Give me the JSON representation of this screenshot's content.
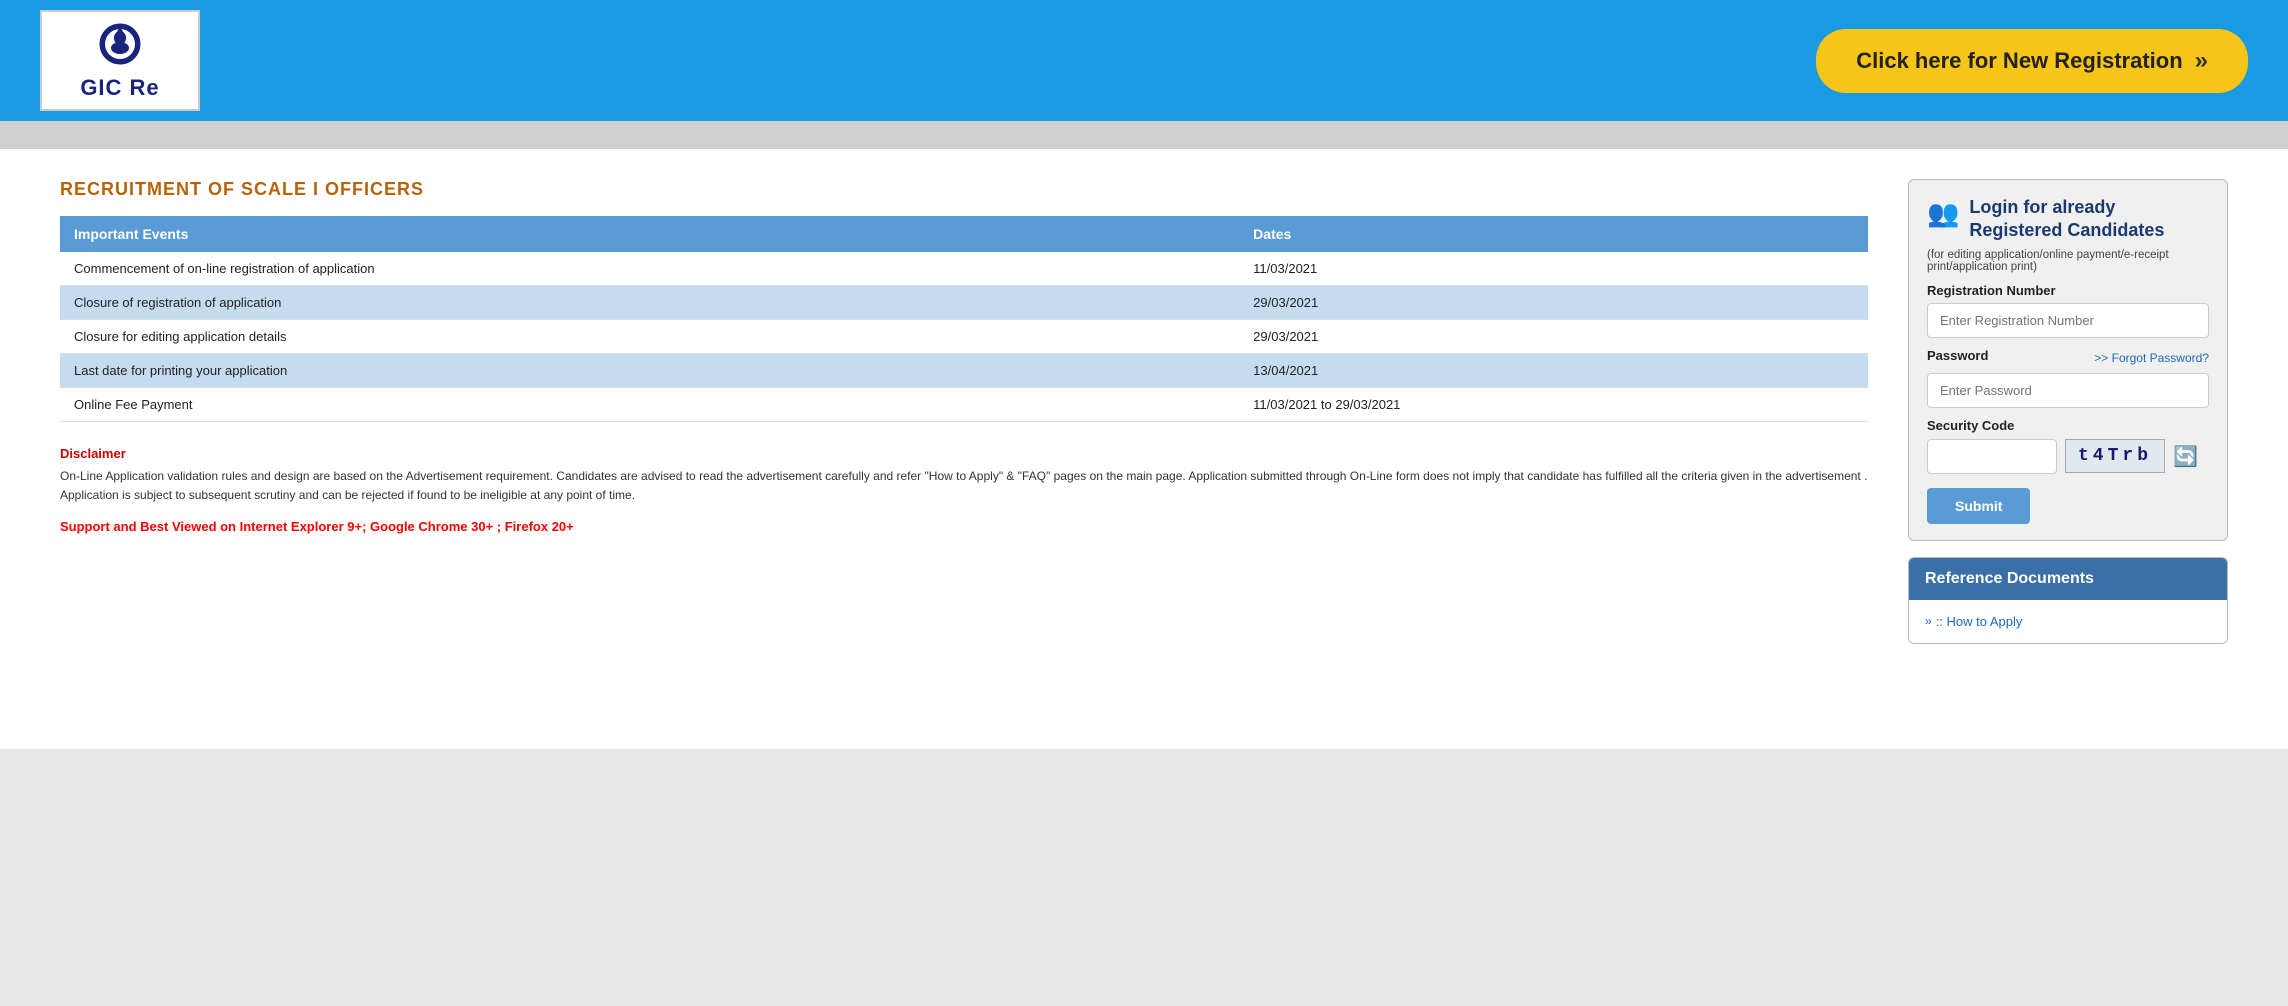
{
  "header": {
    "logo_text": "GIC Re",
    "new_registration_label": "Click here for New Registration",
    "new_registration_chevrons": "»"
  },
  "main": {
    "page_title": "RECRUITMENT OF SCALE I OFFICERS",
    "table": {
      "col_events": "Important Events",
      "col_dates": "Dates",
      "rows": [
        {
          "event": "Commencement of on-line registration of application",
          "date": "11/03/2021",
          "highlighted": false
        },
        {
          "event": "Closure of registration of application",
          "date": "29/03/2021",
          "highlighted": true
        },
        {
          "event": "Closure for editing application details",
          "date": "29/03/2021",
          "highlighted": false
        },
        {
          "event": "Last date for printing your application",
          "date": "13/04/2021",
          "highlighted": true
        },
        {
          "event": "Online Fee Payment",
          "date": "11/03/2021 to 29/03/2021",
          "highlighted": false
        }
      ]
    },
    "disclaimer_title": "Disclaimer",
    "disclaimer_text": "On-Line Application validation rules and design are based on the Advertisement requirement. Candidates are advised to read the advertisement carefully and refer \"How to Apply\" & \"FAQ\" pages on the main page. Application submitted through On-Line form does not imply that candidate has fulfilled all the criteria given in the advertisement . Application is subject to subsequent scrutiny and can be rejected if found to be ineligible at any point of time.",
    "support_text": "Support and Best Viewed on Internet Explorer 9+; Google Chrome 30+ ; Firefox 20+"
  },
  "login_panel": {
    "title": "Login for already\nRegistered Candidates",
    "subtitle": "(for editing application/online payment/e-receipt print/application print)",
    "reg_number_label": "Registration Number",
    "reg_number_placeholder": "Enter Registration Number",
    "password_label": "Password",
    "forgot_label": ">> Forgot Password?",
    "password_placeholder": "Enter Password",
    "security_label": "Security Code",
    "security_input_placeholder": "",
    "captcha_text": "t4Trb",
    "submit_label": "Submit"
  },
  "ref_docs": {
    "header": "Reference Documents",
    "links": [
      {
        "label": ":: How to Apply"
      }
    ]
  }
}
